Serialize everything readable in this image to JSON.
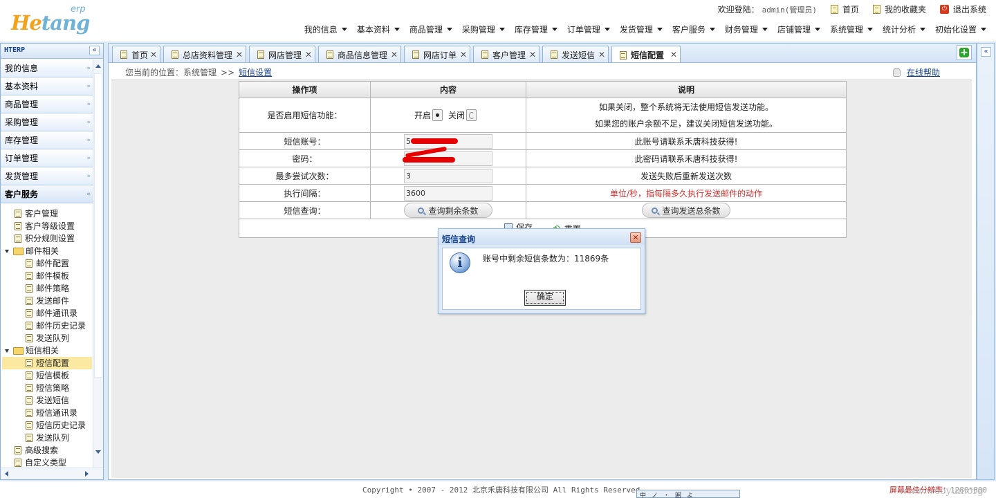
{
  "logo": {
    "main_a": "He",
    "main_b": "tang",
    "sub": "erp"
  },
  "topbar": {
    "welcome": "欢迎登陆：",
    "user": "admin(管理员)",
    "home": "首页",
    "favorites": "我的收藏夹",
    "logout": "退出系统"
  },
  "mainnav": [
    "我的信息",
    "基本资料",
    "商品管理",
    "采购管理",
    "库存管理",
    "订单管理",
    "发货管理",
    "客户服务",
    "财务管理",
    "店铺管理",
    "系统管理",
    "统计分析",
    "初始化设置"
  ],
  "sidebar": {
    "title": "HTERP",
    "menus": [
      "我的信息",
      "基本资料",
      "商品管理",
      "采购管理",
      "库存管理",
      "订单管理",
      "发货管理",
      "客户服务"
    ],
    "active_menu": "客户服务",
    "tree": [
      {
        "label": "客户管理",
        "type": "leaf",
        "level": 1
      },
      {
        "label": "客户等级设置",
        "type": "leaf",
        "level": 1
      },
      {
        "label": "积分规则设置",
        "type": "leaf",
        "level": 1
      },
      {
        "label": "邮件相关",
        "type": "folder",
        "level": 1
      },
      {
        "label": "邮件配置",
        "type": "leaf",
        "level": 2
      },
      {
        "label": "邮件模板",
        "type": "leaf",
        "level": 2
      },
      {
        "label": "邮件策略",
        "type": "leaf",
        "level": 2
      },
      {
        "label": "发送邮件",
        "type": "leaf",
        "level": 2
      },
      {
        "label": "邮件通讯录",
        "type": "leaf",
        "level": 2
      },
      {
        "label": "邮件历史记录",
        "type": "leaf",
        "level": 2
      },
      {
        "label": "发送队列",
        "type": "leaf",
        "level": 2
      },
      {
        "label": "短信相关",
        "type": "folder",
        "level": 1
      },
      {
        "label": "短信配置",
        "type": "leaf",
        "level": 2,
        "selected": true
      },
      {
        "label": "短信模板",
        "type": "leaf",
        "level": 2
      },
      {
        "label": "短信策略",
        "type": "leaf",
        "level": 2
      },
      {
        "label": "发送短信",
        "type": "leaf",
        "level": 2
      },
      {
        "label": "短信通讯录",
        "type": "leaf",
        "level": 2
      },
      {
        "label": "短信历史记录",
        "type": "leaf",
        "level": 2
      },
      {
        "label": "发送队列",
        "type": "leaf",
        "level": 2
      },
      {
        "label": "高级搜索",
        "type": "leaf",
        "level": 1
      },
      {
        "label": "自定义类型",
        "type": "leaf",
        "level": 1
      }
    ]
  },
  "tabs": [
    {
      "label": "首页"
    },
    {
      "label": "总店资料管理"
    },
    {
      "label": "网店管理"
    },
    {
      "label": "商品信息管理"
    },
    {
      "label": "网店订单"
    },
    {
      "label": "客户管理"
    },
    {
      "label": "发送短信"
    },
    {
      "label": "短信配置",
      "active": true
    }
  ],
  "breadcrumb": {
    "prefix": "您当前的位置：",
    "section": "系统管理",
    "sep": ">>",
    "current": "短信设置"
  },
  "help": "在线帮助",
  "table": {
    "headers": [
      "操作项",
      "内容",
      "说明"
    ],
    "enable": {
      "label": "是否启用短信功能：",
      "on": "开启",
      "off": "关闭",
      "selected": "开启",
      "desc1": "如果关闭，整个系统将无法使用短信发送功能。",
      "desc2": "如果您的账户余额不足，建议关闭短信发送功能。"
    },
    "account": {
      "label": "短信账号：",
      "value": "5",
      "desc": "此账号请联系禾唐科技获得!"
    },
    "password": {
      "label": "密码：",
      "value": "",
      "desc": "此密码请联系禾唐科技获得!"
    },
    "retries": {
      "label": "最多尝试次数：",
      "value": "3",
      "desc": "发送失败后重新发送次数"
    },
    "interval": {
      "label": "执行间隔：",
      "value": "3600",
      "desc": "单位/秒，指每隔多久执行发送邮件的动作"
    },
    "query": {
      "label": "短信查询：",
      "btn_left": "查询剩余条数",
      "btn_right": "查询发送总条数"
    },
    "actions": {
      "save": "保存",
      "reset": "重置"
    }
  },
  "dialog": {
    "title": "短信查询",
    "message": "账号中剩余短信条数为：11869条",
    "ok": "确定"
  },
  "footer": {
    "copyright": "Copyright • 2007 - 2012 北京禾唐科技有限公司 All Rights Reserved",
    "best": "屏幕最佳分辨率：",
    "resolution": "1280*800",
    "ime": [
      "中",
      "ノ",
      "・",
      "囲",
      "よ"
    ],
    "watermark": "www.wooyun.org"
  },
  "colors": {
    "accent_blue": "#15428b",
    "frame_blue": "#99bbe8",
    "warning_red": "#d22e2e",
    "selected_yellow": "#fbe9a1"
  }
}
